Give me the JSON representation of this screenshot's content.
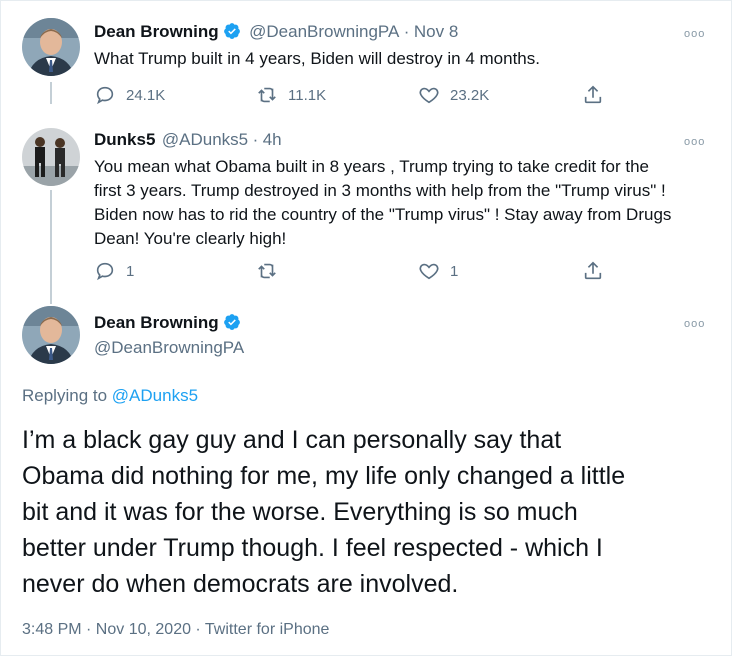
{
  "tweet1": {
    "name": "Dean Browning",
    "handle": "@DeanBrowningPA",
    "time": "Nov 8",
    "sep": "·",
    "text": "What Trump built in 4 years, Biden will destroy in 4 months.",
    "replies": "24.1K",
    "retweets": "11.1K",
    "likes": "23.2K",
    "more": "ooo"
  },
  "tweet2": {
    "name": "Dunks5",
    "handle": "@ADunks5",
    "time": "4h",
    "sep": "·",
    "lines": [
      "You mean what Obama built in 8 years , Trump trying to take credit for the",
      "first 3 years. Trump destroyed in 3 months with help from the \"Trump virus\" !",
      "Biden now has to rid the country of the \"Trump virus\" ! Stay away from Drugs",
      "Dean! You're clearly high!"
    ],
    "replies": "1",
    "retweets": "",
    "likes": "1",
    "more": "ooo"
  },
  "tweet3": {
    "name": "Dean Browning",
    "handle": "@DeanBrowningPA",
    "more": "ooo",
    "replying_label": "Replying to",
    "replying_handle": "@ADunks5",
    "lines": [
      "I’m a black gay guy and I can personally say that",
      "Obama did nothing for me, my life only changed a little",
      "bit and it was for the worse. Everything is so much",
      "better under Trump though. I feel respected - which I",
      "never do when democrats are involved."
    ],
    "timestamp": "3:48 PM · Nov 10, 2020 · Twitter for iPhone"
  },
  "colors": {
    "verified": "#1da1f2",
    "secondary_text": "#5b7083",
    "link": "#1da1f2",
    "thread_line": "#c4cfd6"
  },
  "icons": [
    "reply-icon",
    "retweet-icon",
    "like-icon",
    "share-icon",
    "verified-badge-icon",
    "more-options-icon"
  ]
}
